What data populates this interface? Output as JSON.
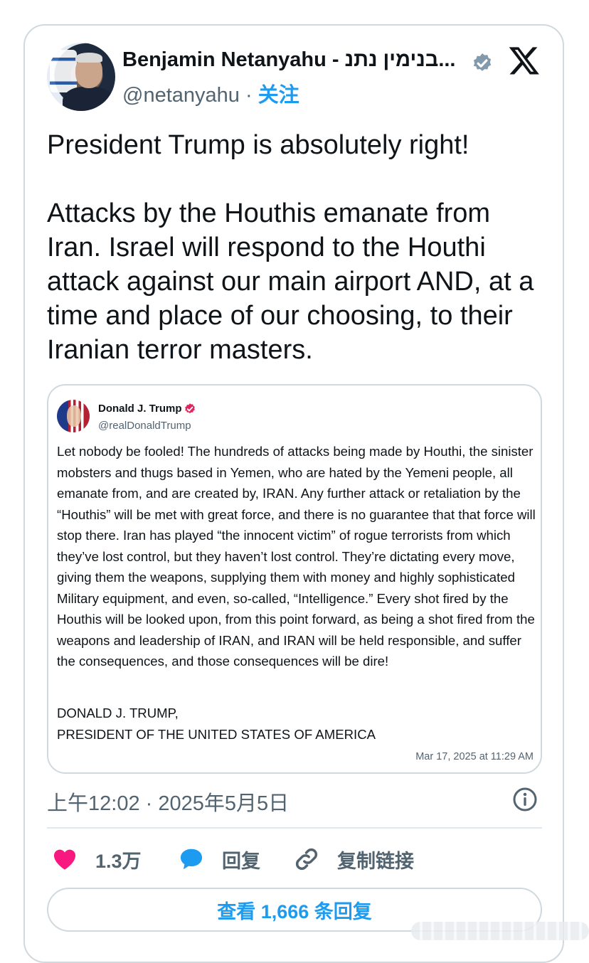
{
  "author": {
    "name": "Benjamin Netanyahu - בנימין נתנ...",
    "handle": "@netanyahu",
    "separator": "·",
    "follow_label": "关注"
  },
  "tweet": {
    "text": "President Trump is absolutely right!\n\nAttacks by the Houthis emanate from Iran. Israel will respond to the Houthi attack against our main airport AND, at a time and place of our choosing, to their Iranian terror masters.",
    "timestamp": "上午12:02 · 2025年5月5日"
  },
  "quote": {
    "name": "Donald J. Trump",
    "handle": "@realDonaldTrump",
    "body": "Let nobody be fooled! The hundreds of attacks being made by Houthi, the sinister mobsters and thugs based in Yemen, who are hated by the Yemeni people, all emanate from, and are created by, IRAN. Any further attack or retaliation by the “Houthis” will be met with great force, and there is no guarantee that that force will stop there. Iran has played “the innocent victim” of rogue terrorists from which they’ve lost control, but they haven’t lost control. They’re dictating every move, giving them the weapons, supplying them with money and highly sophisticated Military equipment, and even, so-called, “Intelligence.” Every shot fired by the Houthis will be looked upon, from this point forward, as being a shot fired from the weapons and leadership of IRAN, and IRAN will be held responsible, and suffer the consequences, and those consequences will be dire!",
    "signature_line1": "DONALD J. TRUMP,",
    "signature_line2": "PRESIDENT OF THE UNITED STATES OF AMERICA",
    "time": "Mar 17, 2025 at 11:29 AM"
  },
  "actions": {
    "like_count": "1.3万",
    "reply_label": "回复",
    "copy_link_label": "复制链接"
  },
  "view_replies_label": "查看 1,666 条回复",
  "colors": {
    "accent": "#1d9bf0",
    "like": "#f91880",
    "muted": "#536471",
    "verified_gray": "#829aab",
    "verified_pink": "#e0245e"
  },
  "icons": [
    "verified-badge-icon",
    "x-logo-icon",
    "info-icon",
    "heart-icon",
    "reply-bubble-icon",
    "link-icon"
  ]
}
